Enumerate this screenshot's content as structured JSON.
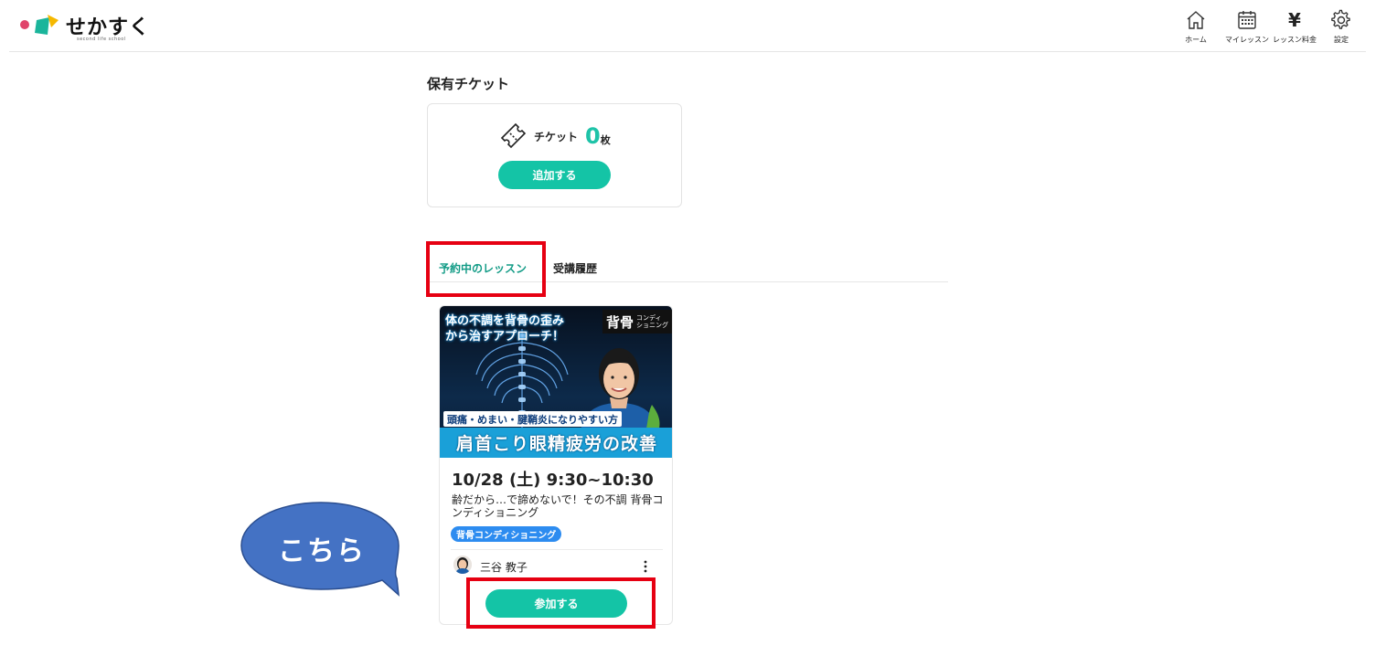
{
  "header": {
    "logo_text": "せかすく",
    "logo_sub": "second life school",
    "nav": [
      {
        "label": "ホーム",
        "icon": "home-icon"
      },
      {
        "label": "マイレッスン",
        "icon": "calendar-icon"
      },
      {
        "label": "レッスン料金",
        "icon": "yen-icon",
        "glyph": "¥"
      },
      {
        "label": "設定",
        "icon": "gear-icon"
      }
    ]
  },
  "tickets": {
    "title": "保有チケット",
    "label": "チケット",
    "count": "0",
    "unit": "枚",
    "add_button": "追加する",
    "icon": "ticket-icon"
  },
  "tabs": [
    {
      "label": "予約中のレッスン",
      "active": true
    },
    {
      "label": "受講履歴",
      "active": false
    }
  ],
  "lesson": {
    "thumbnail": {
      "headline_line1": "体の不調を背骨の歪み",
      "headline_line2": "から治すアプローチ！",
      "brand_main": "背骨",
      "brand_sub_line1": "コンディ",
      "brand_sub_line2": "ショニング",
      "sub_banner": "頭痛・めまい・腱鞘炎になりやすい方",
      "main_banner": "肩首こり眼精疲労の改善"
    },
    "date": "10/28 (土) 9:30~10:30",
    "title": "齢だから…で諦めないで！その不調 背骨コンディショニング",
    "tag": "背骨コンディショニング",
    "instructor": "三谷 教子",
    "join_button": "参加する"
  },
  "callout": {
    "text": "こちら"
  },
  "colors": {
    "accent": "#14c4a6",
    "tab_active": "#129b86",
    "tag_blue": "#2d8cf0",
    "highlight_red": "#e60012",
    "bubble_blue": "#4472c4"
  }
}
